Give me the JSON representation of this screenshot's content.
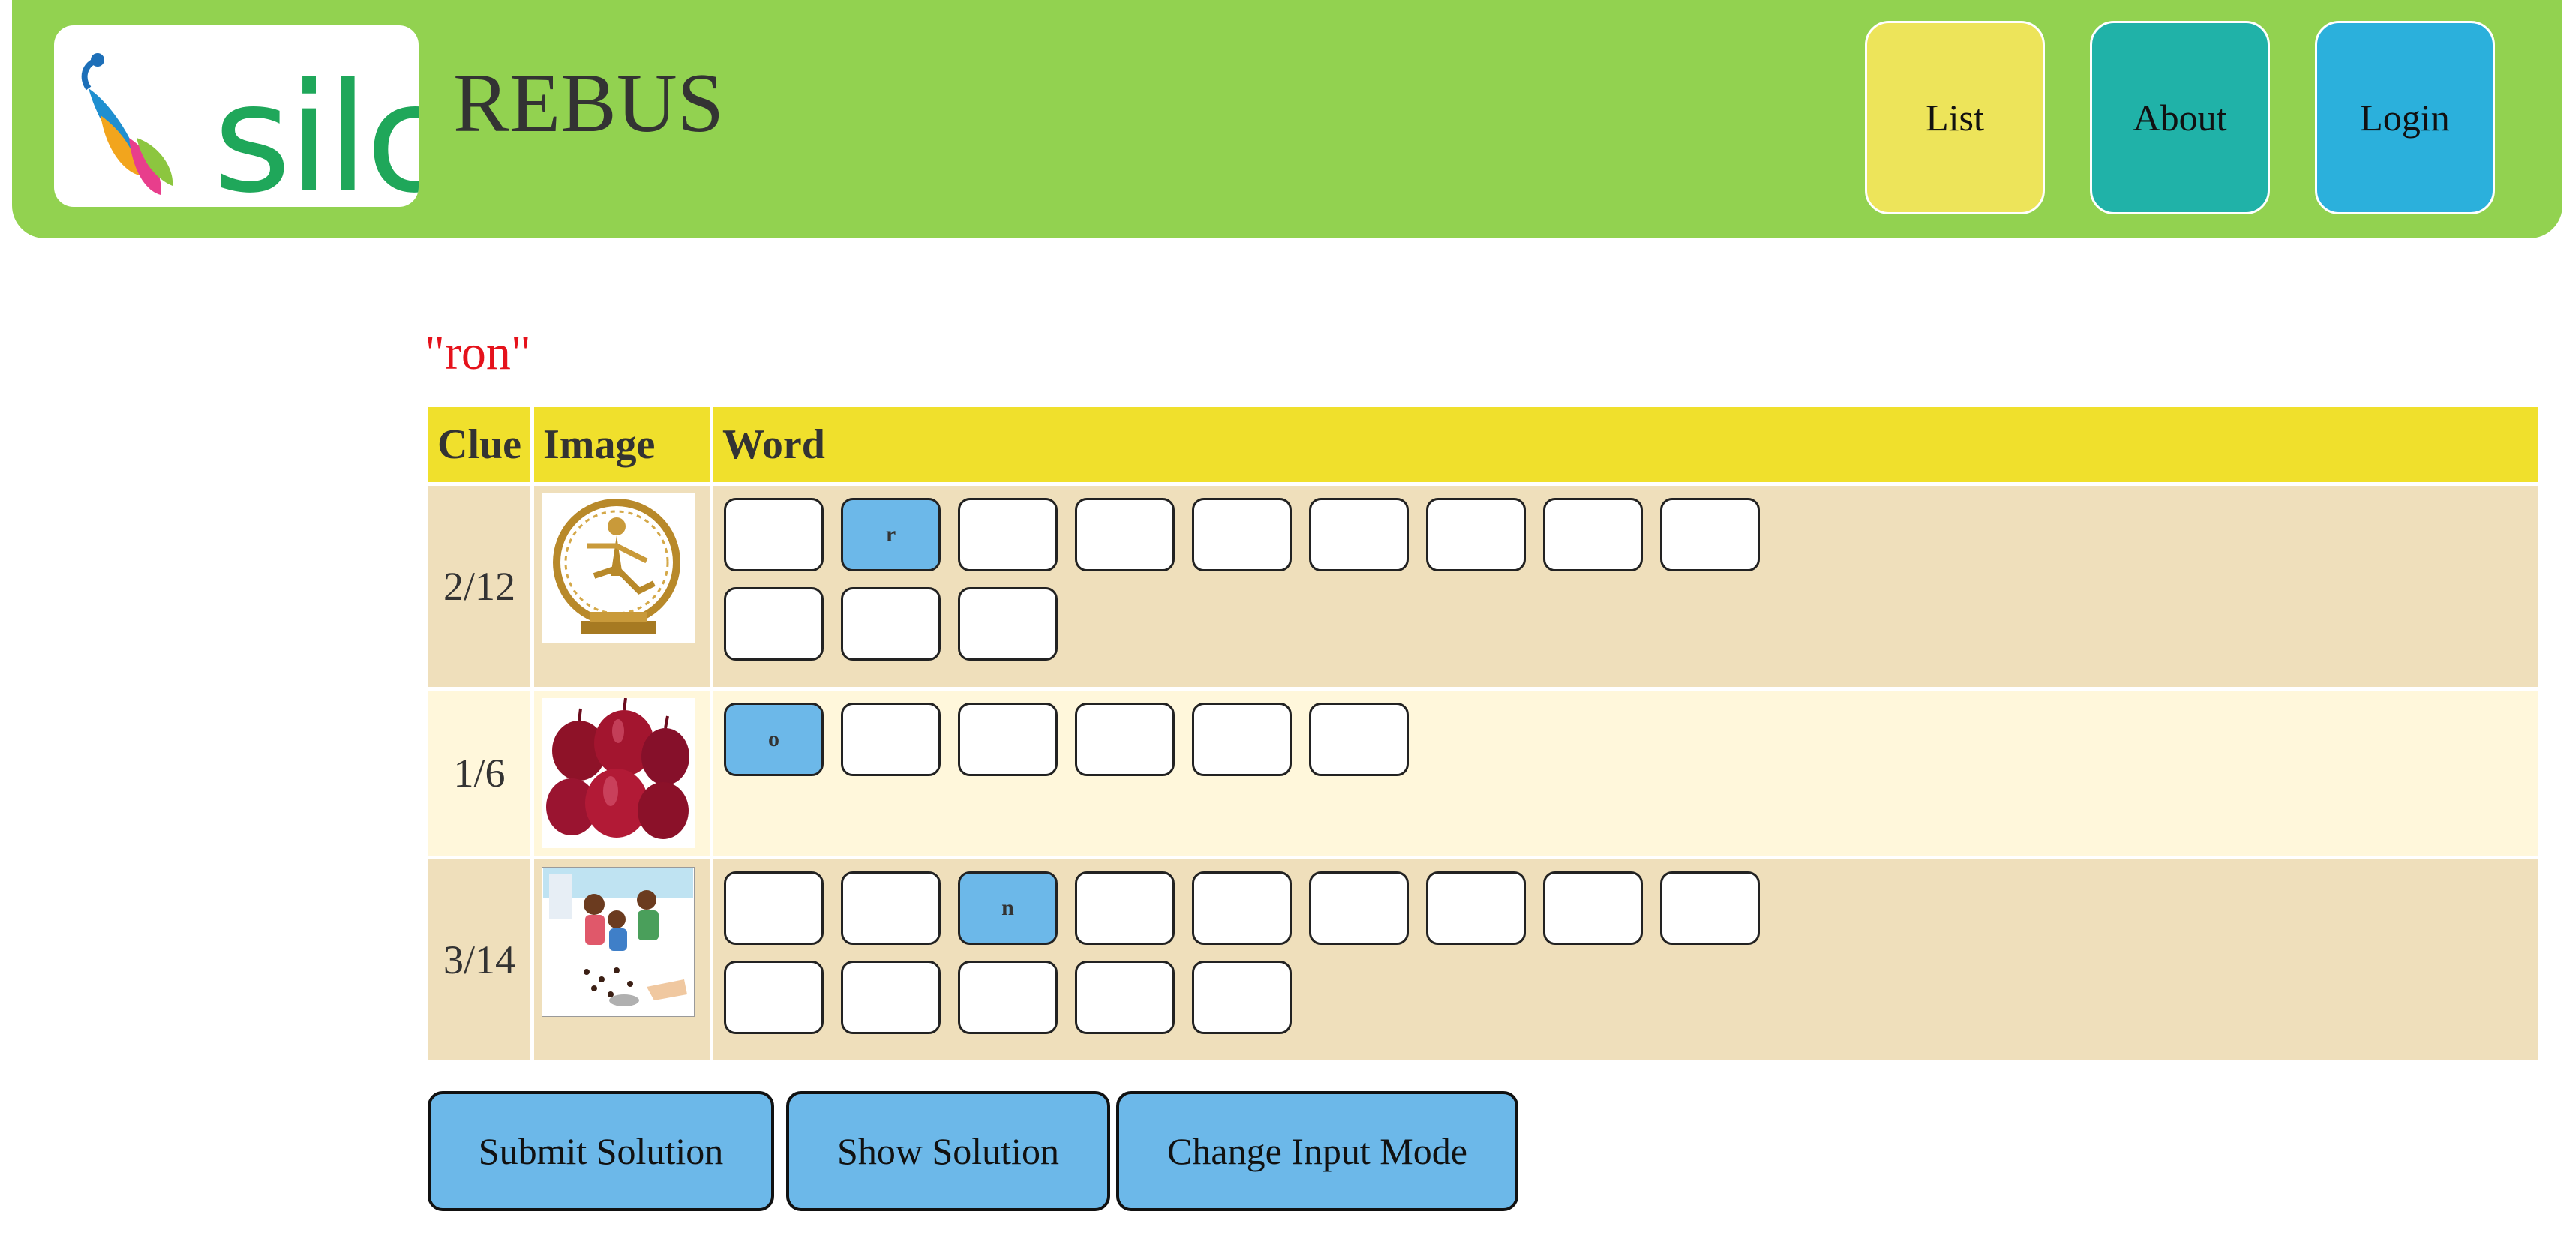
{
  "header": {
    "logo_text": "silc",
    "title": "REBUS",
    "nav": {
      "list": "List",
      "about": "About",
      "login": "Login"
    },
    "colors": {
      "bar": "#92d250",
      "list": "#ede45a",
      "about": "#20b2a8",
      "login": "#2bb0dc"
    }
  },
  "puzzle": {
    "answer_hint": "\"ron\"",
    "columns": {
      "clue": "Clue",
      "image": "Image",
      "word": "Word"
    },
    "rows": [
      {
        "clue": "2/12",
        "image": "nataraja-statue",
        "letters": [
          "",
          "r",
          "",
          "",
          "",
          "",
          "",
          "",
          "",
          "",
          "",
          ""
        ]
      },
      {
        "clue": "1/6",
        "image": "red-onions",
        "letters": [
          "o",
          "",
          "",
          "",
          "",
          ""
        ]
      },
      {
        "clue": "3/14",
        "image": "children-illustration",
        "letters": [
          "",
          "",
          "n",
          "",
          "",
          "",
          "",
          "",
          "",
          "",
          "",
          "",
          "",
          ""
        ]
      }
    ]
  },
  "actions": {
    "submit": "Submit Solution",
    "show": "Show Solution",
    "change_mode": "Change Input Mode"
  }
}
